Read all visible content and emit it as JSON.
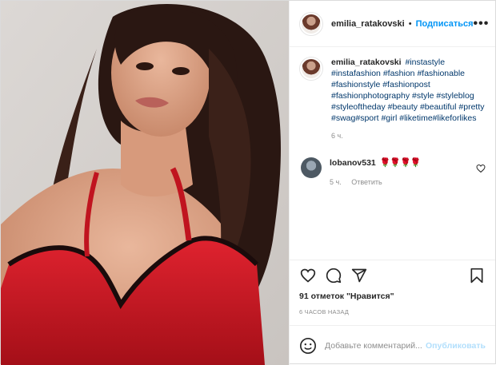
{
  "post": {
    "username": "emilia_ratakovski",
    "separator": "•",
    "follow_label": "Подписаться",
    "more_glyph": "•••"
  },
  "caption": {
    "username": "emilia_ratakovski",
    "hashtags": [
      "#instastyle",
      "#instafashion",
      "#fashion",
      "#fashionable",
      "#fashionstyle",
      "#fashionpost",
      "#fashionphotography",
      "#style",
      "#styleblog",
      "#styleoftheday",
      "#beauty",
      "#beautiful",
      "#pretty",
      "#swag",
      "#sport",
      "#girl",
      "#liketime",
      "#likeforlikes"
    ],
    "time": "6 ч."
  },
  "comment": {
    "username": "lobanov531",
    "text": "🌹🌹🌹🌹",
    "time": "5 ч.",
    "reply_label": "Ответить"
  },
  "actions": {
    "icons": [
      "heart-icon",
      "comment-icon",
      "share-icon",
      "bookmark-icon"
    ]
  },
  "likes": {
    "text": "91 отметок \"Нравится\""
  },
  "posted": {
    "text": "6 ЧАСОВ НАЗАД"
  },
  "add_comment": {
    "placeholder": "Добавьте комментарий...",
    "publish_label": "Опубликовать"
  },
  "colors": {
    "link_blue": "#0095f6",
    "hashtag": "#00376b",
    "muted": "#8e8e8e",
    "publish_disabled": "#b2dffc",
    "dress_red": "#d11a26"
  }
}
